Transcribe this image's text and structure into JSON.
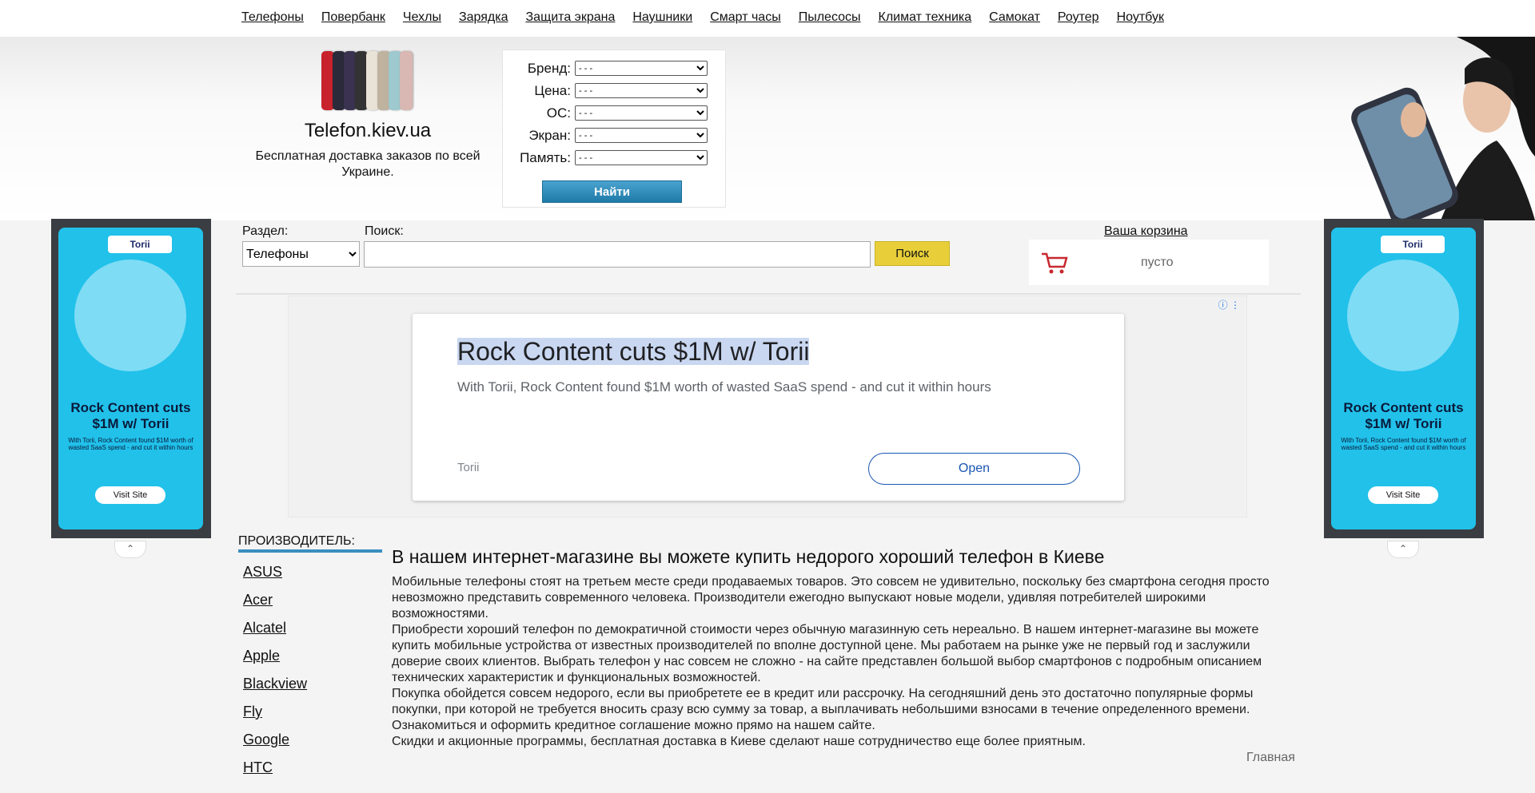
{
  "nav": [
    "Телефоны",
    "Повербанк",
    "Чехлы",
    "Зарядка",
    "Защита экрана",
    "Наушники",
    "Смарт часы",
    "Пылесосы",
    "Климат техника",
    "Самокат",
    "Роутер",
    "Ноутбук"
  ],
  "site": {
    "name": "Telefon.kiev.ua",
    "tagline": "Бесплатная доставка заказов по всей Украине."
  },
  "filters": [
    {
      "label": "Бренд:",
      "value": "- - -"
    },
    {
      "label": "Цена:",
      "value": "- - -"
    },
    {
      "label": "ОС:",
      "value": "- - -"
    },
    {
      "label": "Экран:",
      "value": "- - -"
    },
    {
      "label": "Память:",
      "value": "- - -"
    }
  ],
  "find_button": "Найти",
  "search": {
    "section_label": "Раздел:",
    "section_value": "Телефоны",
    "query_label": "Поиск:",
    "query_value": "",
    "button": "Поиск"
  },
  "cart": {
    "title": "Ваша корзина",
    "status": "пусто"
  },
  "side_ad": {
    "brand": "Torii",
    "headline": "Rock Content cuts $1M w/ Torii",
    "desc": "With Torii, Rock Content found $1M worth of wasted SaaS spend - and cut it within hours",
    "cta": "Visit Site"
  },
  "main_ad": {
    "title": "Rock Content cuts $1M w/ Torii",
    "desc": "With Torii, Rock Content found $1M worth of wasted SaaS spend - and cut it within hours",
    "advertiser": "Torii",
    "cta": "Open"
  },
  "manufacturers": {
    "title": "ПРОИЗВОДИТЕЛЬ:",
    "items": [
      "ASUS",
      "Acer",
      "Alcatel",
      "Apple",
      "Blackview",
      "Fly",
      "Google",
      "HTC"
    ]
  },
  "content": {
    "heading": "В нашем интернет-магазине вы можете купить недорого хороший телефон в Киеве",
    "p1": "Мобильные телефоны стоят на третьем месте среди продаваемых товаров. Это совсем не удивительно, поскольку без смартфона сегодня просто невозможно представить современного человека. Производители ежегодно выпускают новые модели, удивляя потребителей широкими возможностями.",
    "p2": "Приобрести хороший телефон по демократичной стоимости через обычную магазинную сеть нереально. В нашем интернет-магазине вы можете купить мобильные устройства от известных производителей по вполне доступной цене. Мы работаем на рынке уже не первый год и заслужили доверие своих клиентов. Выбрать телефон у нас совсем не сложно - на сайте представлен большой выбор смартфонов с подробным описанием технических характеристик и функциональных возможностей.",
    "p3": "Покупка обойдется совсем недорого, если вы приобретете ее в кредит или рассрочку. На сегодняшний день это достаточно популярные формы покупки, при которой не требуется вносить сразу всю сумму за товар, а выплачивать небольшими взносами в течение определенного времени. Ознакомиться и оформить кредитное соглашение можно прямо на нашем сайте.",
    "p4": "Скидки и акционные программы, бесплатная доставка в Киеве сделают наше сотрудничество еще более приятным."
  },
  "breadcrumb": "Главная",
  "colors": {
    "accent_blue": "#1f7aa8",
    "search_yellow": "#e8cf3a",
    "ad_cyan": "#21c1ea"
  }
}
